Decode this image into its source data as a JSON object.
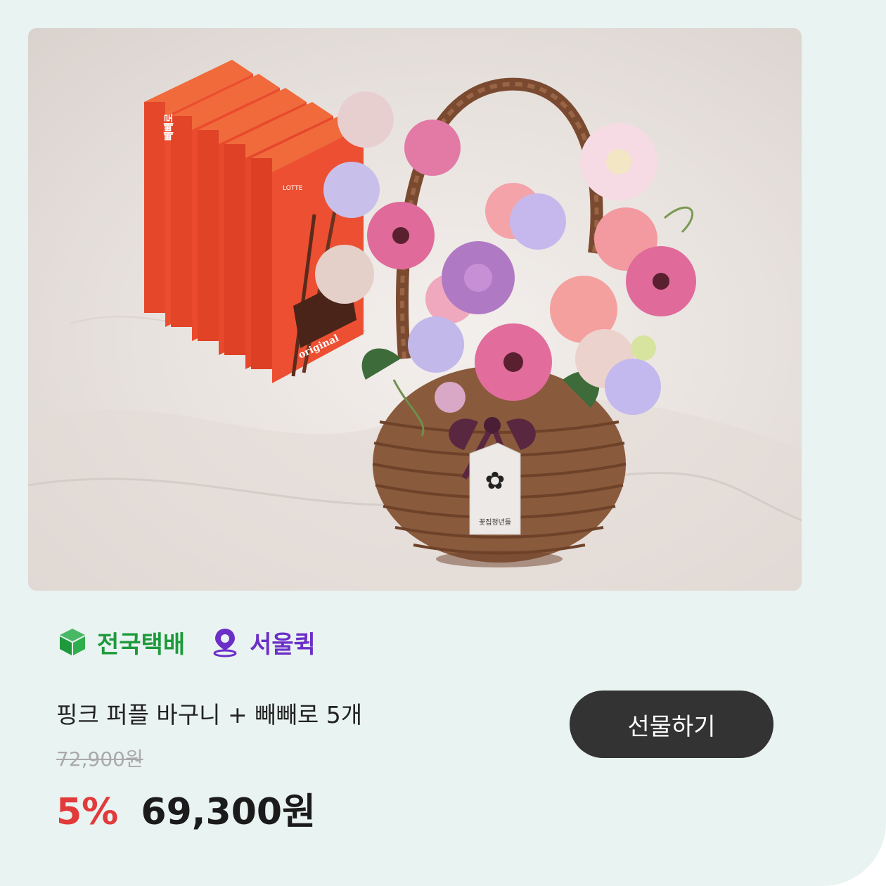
{
  "product": {
    "image_alt": "Flower basket with five Pepero boxes",
    "badges": [
      {
        "label": "전국택배",
        "icon": "box-icon",
        "color": "#1e9a3c"
      },
      {
        "label": "서울퀵",
        "icon": "location-pin-icon",
        "color": "#6b2fc8"
      }
    ],
    "title": "핑크 퍼플 바구니 + 빼빼로 5개",
    "original_price": "72,900원",
    "discount": "5%",
    "price": "69,300원",
    "gift_button_label": "선물하기",
    "tag_text": "꽃집청년들",
    "box_texts": {
      "brand": "LOTTE",
      "name": "빼빼로",
      "variant": "original"
    }
  },
  "colors": {
    "background": "#e9f3f1",
    "discount": "#e23a3a",
    "button": "#333333"
  }
}
